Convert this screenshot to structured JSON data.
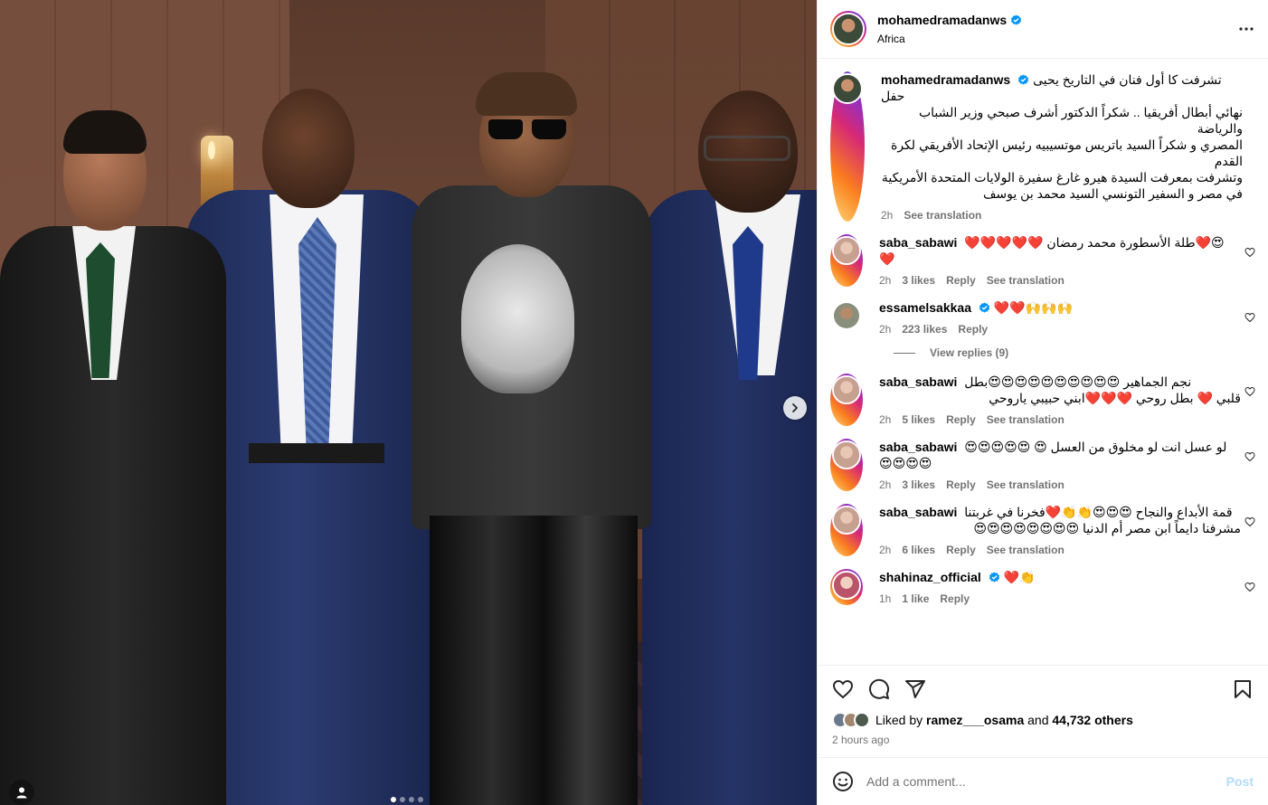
{
  "post": {
    "username": "mohamedramadanws",
    "location": "Africa",
    "caption_lines": [
      "تشرفت كا أول فنان في التاريخ يحيى حفل",
      "نهائي أبطال أفريقيا .. شكراً الدكتور أشرف صبحي وزير الشباب والرياضة",
      "المصري و شكراً السيد باتريس موتسيبيه رئيس الإتحاد الأفريقي لكرة",
      "القدم",
      "وتشرفت بمعرفت السيدة هيرو غارغ سفيرة الولايات المتحدة الأمريكية",
      "في مصر و السفير التونسي السيد محمد بن يوسف"
    ],
    "caption_time": "2h",
    "see_translation": "See translation"
  },
  "comments": [
    {
      "user": "saba_sabawi",
      "verified": false,
      "lines": [
        "😍❤️طلة الأسطورة محمد رمضان ❤️❤️❤️❤️❤️",
        "❤️"
      ],
      "time": "2h",
      "likes": "3 likes",
      "reply": "Reply",
      "translate": "See translation",
      "avatar_color": "#c7a18f"
    },
    {
      "user": "essamelsakkaa",
      "verified": true,
      "lines": [
        "❤️❤️🙌🙌🙌"
      ],
      "time": "2h",
      "likes": "223 likes",
      "reply": "Reply",
      "translate": "",
      "avatar_color": "#8a8f7c"
    },
    {
      "user": "saba_sabawi",
      "verified": false,
      "lines": [
        "نجم الجماهير 😍😍😍😍😍😍😍😍😍😍بطل",
        "قلبي ❤️ بطل روحي ❤️❤️❤️ابني حبيبي ياروحي"
      ],
      "time": "2h",
      "likes": "5 likes",
      "reply": "Reply",
      "translate": "See translation",
      "avatar_color": "#c7a18f"
    },
    {
      "user": "saba_sabawi",
      "verified": false,
      "lines": [
        "لو عسل انت لو مخلوق من العسل 😍 😍😍😍😍😍",
        "😍😍😍😍"
      ],
      "time": "2h",
      "likes": "3 likes",
      "reply": "Reply",
      "translate": "See translation",
      "avatar_color": "#c7a18f"
    },
    {
      "user": "saba_sabawi",
      "verified": false,
      "lines": [
        "قمة الأبداع والنجاح 😍😍😍👏👏❤️فخرنا في غربتنا",
        "مشرفنا دايماً ابن مصر أم الدنيا 😍😍😍😍😍😍😍😍"
      ],
      "time": "2h",
      "likes": "6 likes",
      "reply": "Reply",
      "translate": "See translation",
      "avatar_color": "#c7a18f"
    },
    {
      "user": "shahinaz_official",
      "verified": true,
      "lines": [
        "❤️👏"
      ],
      "time": "1h",
      "likes": "1 like",
      "reply": "Reply",
      "translate": "",
      "avatar_color": "#b9546a"
    }
  ],
  "view_replies": "View replies (9)",
  "likes_line": {
    "prefix": "Liked by ",
    "user": "ramez___osama",
    "mid": " and ",
    "count": "44,732 others"
  },
  "time_ago": "2 hours ago",
  "add_comment": {
    "placeholder": "Add a comment...",
    "post_label": "Post"
  },
  "icons": {
    "more": "more-dots-icon",
    "like": "heart-icon",
    "comment": "comment-icon",
    "share": "share-icon",
    "save": "bookmark-icon",
    "emoji": "emoji-icon",
    "next": "chevron-right-icon",
    "tag": "user-tag-icon"
  },
  "colors": {
    "verified": "#0095f6",
    "muted": "#737373",
    "post_disabled": "#b3dbff"
  },
  "carousel": {
    "total": 4,
    "current": 1
  }
}
